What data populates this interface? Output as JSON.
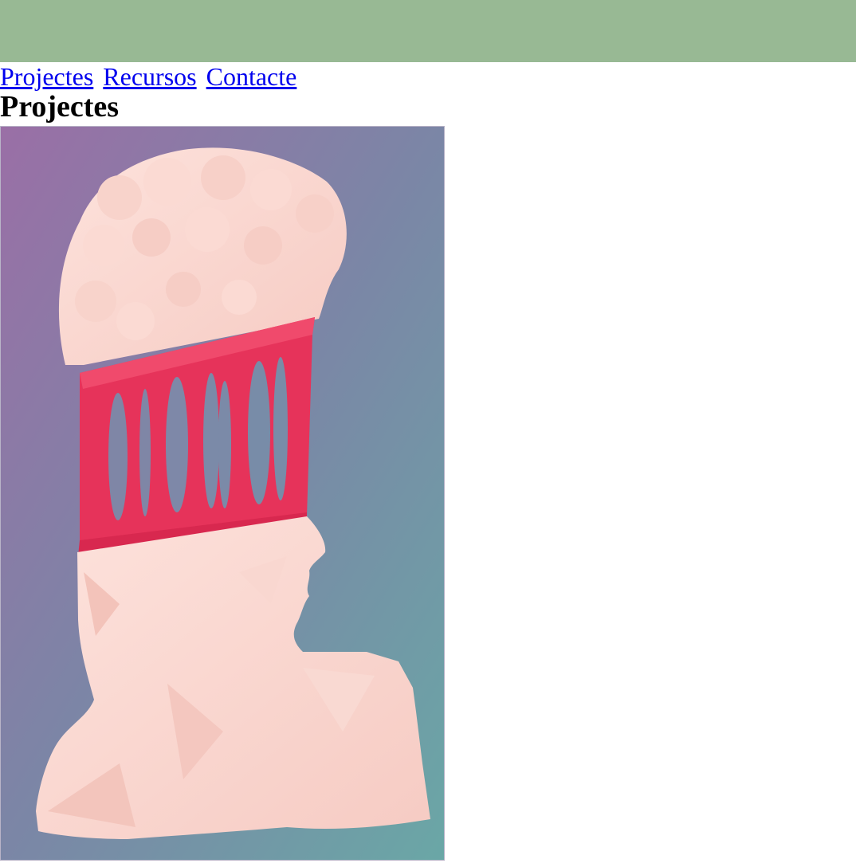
{
  "nav": {
    "links": [
      "Projectes",
      "Recursos",
      "Contacte"
    ]
  },
  "page": {
    "title": "Projectes"
  },
  "colors": {
    "banner": "#98b994",
    "link": "#0000ee",
    "art_gradient_top": "#9a6fa6",
    "art_gradient_bottom": "#6aa7a6",
    "statue": "#fbd6cf",
    "glitch": "#e6335a"
  },
  "image": {
    "subject": "statue-bust-artwork"
  }
}
